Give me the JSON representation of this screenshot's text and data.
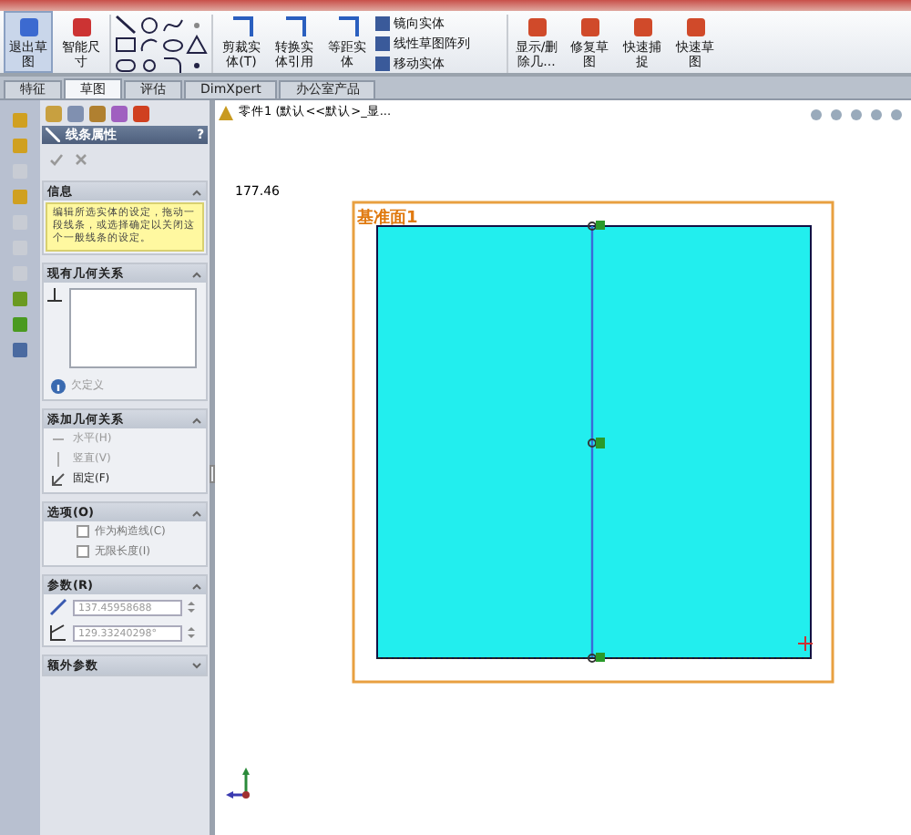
{
  "ribbon": {
    "big_buttons": [
      {
        "label": "退出草图",
        "selected": true
      },
      {
        "label": "智能尺寸",
        "selected": false
      }
    ],
    "tool_buttons": [
      {
        "label": "剪裁实体(T)"
      },
      {
        "label": "转换实体引用"
      },
      {
        "label": "等距实体"
      }
    ],
    "list_buttons": [
      {
        "label": "镜向实体"
      },
      {
        "label": "线性草图阵列"
      },
      {
        "label": "移动实体"
      }
    ],
    "right_buttons": [
      {
        "label": "显示/删除几..."
      },
      {
        "label": "修复草图"
      },
      {
        "label": "快速捕捉"
      },
      {
        "label": "快速草图"
      }
    ]
  },
  "tabs": [
    {
      "label": "特征",
      "selected": false
    },
    {
      "label": "草图",
      "selected": true
    },
    {
      "label": "评估",
      "selected": false
    },
    {
      "label": "DimXpert",
      "selected": false
    },
    {
      "label": "办公室产品",
      "selected": false
    }
  ],
  "breadcrumb": "零件1 (默认<<默认>_显...",
  "property_manager": {
    "title": "线条属性",
    "help": "?",
    "sections": [
      {
        "kind": "message",
        "title": "信息",
        "text": "编辑所选实体的设定，拖动一段线条，或选择确定以关闭这个一般线条的设定。"
      },
      {
        "kind": "relations",
        "title": "现有几何关系",
        "status": "欠定义"
      },
      {
        "kind": "actions",
        "title": "添加几何关系",
        "items": [
          {
            "label": "水平(H)",
            "disabled": true
          },
          {
            "label": "竖直(V)",
            "disabled": true
          },
          {
            "label": "固定(F)",
            "disabled": false
          }
        ]
      },
      {
        "kind": "options",
        "title": "选项(O)",
        "items": [
          {
            "label": "作为构造线(C)",
            "checked": false
          },
          {
            "label": "无限长度(I)",
            "checked": false
          }
        ]
      },
      {
        "kind": "params",
        "title": "参数(R)",
        "items": [
          {
            "value": "137.45958688"
          },
          {
            "value": "129.33240298°"
          }
        ]
      },
      {
        "kind": "collapsed",
        "title": "额外参数"
      }
    ]
  },
  "canvas": {
    "dimension": "177.46",
    "plane": "基准面1"
  }
}
